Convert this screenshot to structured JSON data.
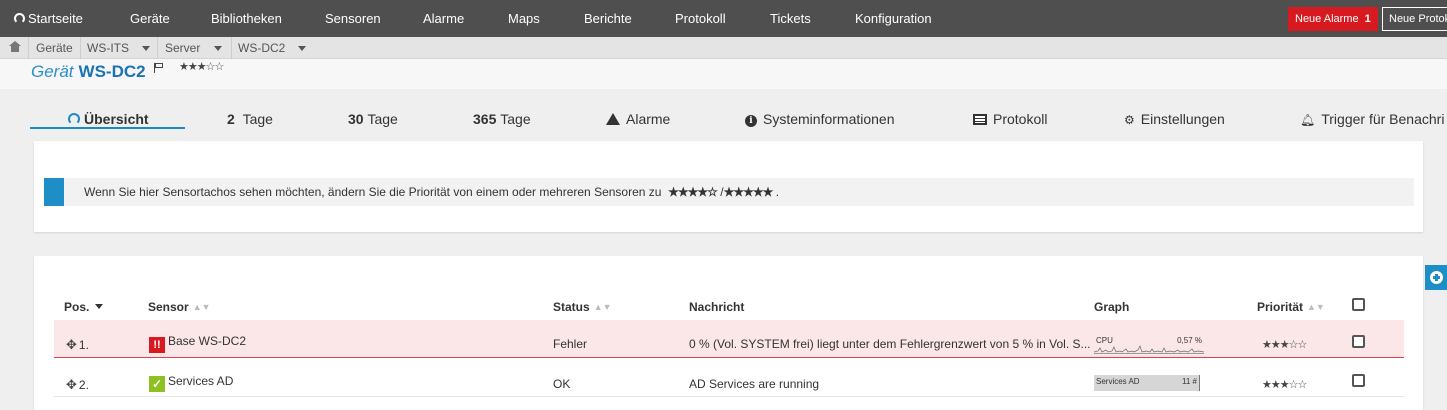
{
  "nav": {
    "items": [
      "Startseite",
      "Geräte",
      "Bibliotheken",
      "Sensoren",
      "Alarme",
      "Maps",
      "Berichte",
      "Protokoll",
      "Tickets",
      "Konfiguration"
    ],
    "new_alarms_label": "Neue Alarme",
    "new_alarms_count": "1",
    "new_log_label": "Neue Protok"
  },
  "breadcrumb": {
    "items": [
      "Geräte",
      "WS-ITS",
      "Server",
      "WS-DC2"
    ]
  },
  "device": {
    "prefix": "Gerät",
    "name": "WS-DC2",
    "stars": "★★★☆☆"
  },
  "tabs": [
    {
      "number": "",
      "label": "Übersicht"
    },
    {
      "number": "2",
      "label": "Tage"
    },
    {
      "number": "30",
      "label": "Tage"
    },
    {
      "number": "365",
      "label": "Tage"
    },
    {
      "number": "",
      "label": "Alarme"
    },
    {
      "number": "",
      "label": "Systeminformationen"
    },
    {
      "number": "",
      "label": "Protokoll"
    },
    {
      "number": "",
      "label": "Einstellungen"
    },
    {
      "number": "",
      "label": "Trigger für Benachri"
    }
  ],
  "info": {
    "text": "Wenn Sie hier Sensortachos sehen möchten, ändern Sie die Priorität von einem oder mehreren Sensoren zu",
    "stars_a": "★★★★☆",
    "separator": "/",
    "stars_b": "★★★★★",
    "suffix": "."
  },
  "table": {
    "headers": {
      "pos": "Pos.",
      "sensor": "Sensor",
      "status": "Status",
      "message": "Nachricht",
      "graph": "Graph",
      "priority": "Priorität"
    },
    "rows": [
      {
        "pos": "1.",
        "sensor": "Base WS-DC2",
        "status": "Fehler",
        "message": "0 % (Vol. SYSTEM frei) liegt unter dem Fehlergrenzwert von 5 % in Vol. S...",
        "graph_label": "CPU",
        "graph_value": "0,57 %",
        "stars": "★★★☆☆"
      },
      {
        "pos": "2.",
        "sensor": "Services AD",
        "status": "OK",
        "message": "AD Services are running",
        "graph_label": "Services AD",
        "graph_value": "11 #",
        "stars": "★★★☆☆"
      }
    ]
  },
  "colors": {
    "nav_bg": "#4f4f4f",
    "accent": "#1e88c6",
    "alarm": "#d71920",
    "ok": "#8ec01f",
    "error_row": "#fbe7e8"
  }
}
